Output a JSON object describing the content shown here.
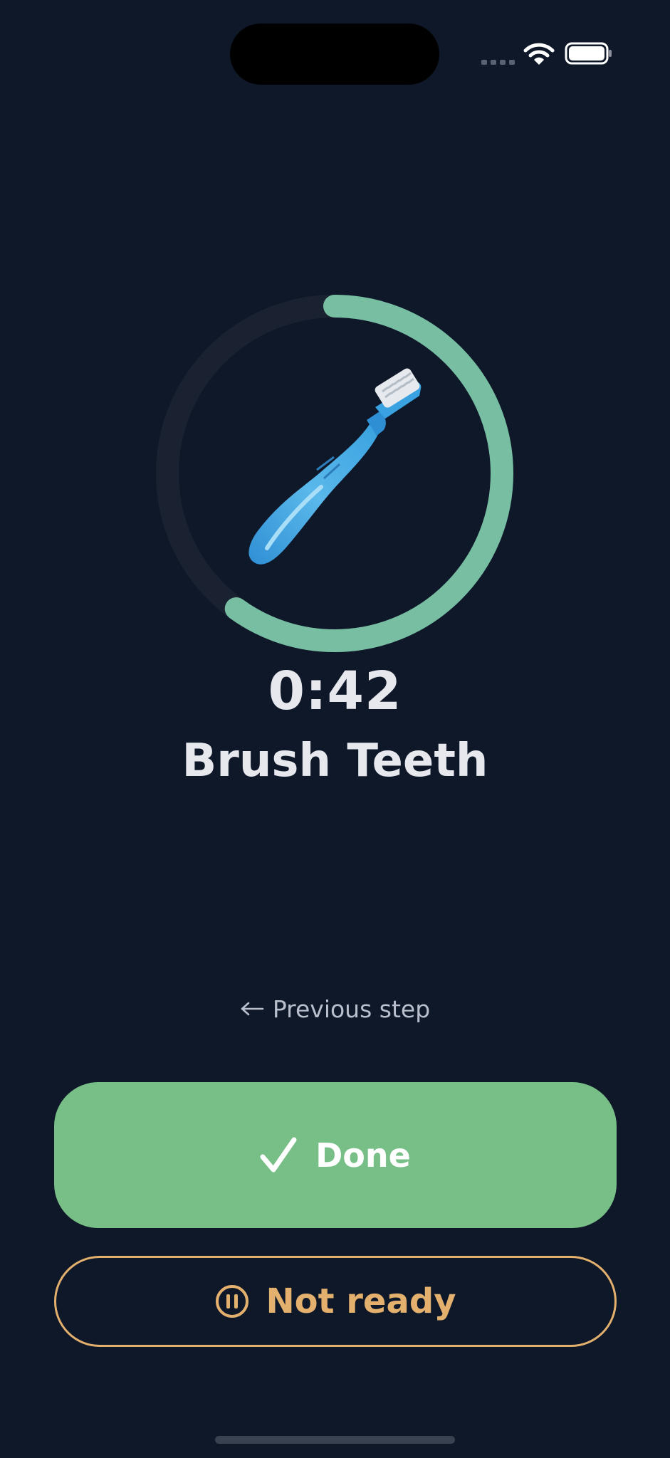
{
  "status_bar": {
    "signal_icon": "cellular-signal-icon",
    "wifi_icon": "wifi-icon",
    "battery_icon": "battery-full-icon"
  },
  "routine_step": {
    "emoji": "🪥",
    "timer": "0:42",
    "title": "Brush Teeth",
    "progress_fraction": 0.6,
    "progress_color": "#77bea2",
    "track_color": "#1a2232"
  },
  "nav": {
    "previous_label": "Previous step",
    "previous_icon": "arrow-left-icon"
  },
  "actions": {
    "done_label": "Done",
    "done_icon": "checkmark-icon",
    "done_color": "#77bf87",
    "not_ready_label": "Not ready",
    "not_ready_icon": "pause-circle-icon",
    "not_ready_color": "#e3b06d"
  },
  "theme": {
    "background": "#0f1829"
  }
}
